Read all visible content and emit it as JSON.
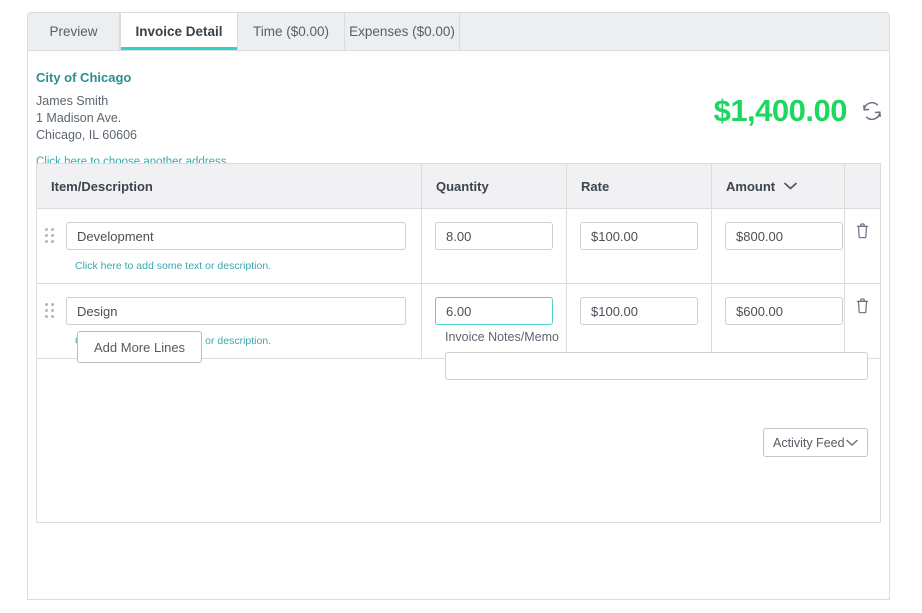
{
  "tabs": [
    {
      "label": "Preview",
      "active": false
    },
    {
      "label": "Invoice Detail",
      "active": true
    },
    {
      "label": "Time ($0.00)",
      "active": false
    },
    {
      "label": "Expenses ($0.00)",
      "active": false
    }
  ],
  "address": {
    "company": "City of Chicago",
    "contact": "James Smith",
    "street": "1 Madison Ave.",
    "city_state_zip": "Chicago, IL 60606",
    "change_link": "Click here to choose another address."
  },
  "total": {
    "amount": "$1,400.00",
    "refresh_icon": "refresh-icon",
    "color": "#1ed760"
  },
  "table": {
    "headers": {
      "description": "Item/Description",
      "quantity": "Quantity",
      "rate": "Rate",
      "amount": "Amount",
      "amount_sort_icon": "chevron-down-icon",
      "delete": ""
    },
    "rows": [
      {
        "drag_handle_icon": "drag-handle-icon",
        "description": "Development",
        "description_placeholder": "",
        "sub_link": "Click here to add some text or description.",
        "quantity": "8.00",
        "rate": "$100.00",
        "amount": "$800.00",
        "delete_icon": "trash-icon",
        "focused_field": ""
      },
      {
        "drag_handle_icon": "drag-handle-icon",
        "description": "Design",
        "description_placeholder": "",
        "sub_link": "Click here to add some text or description.",
        "quantity": "6.00",
        "rate": "$100.00",
        "amount": "$600.00",
        "delete_icon": "trash-icon",
        "focused_field": "quantity"
      }
    ]
  },
  "footer": {
    "add_lines_label": "Add More Lines",
    "notes_label": "Invoice Notes/Memo",
    "notes_value": "",
    "notes_placeholder": "",
    "activity_feed_label": "Activity Feed",
    "activity_feed_icon": "chevron-down-icon"
  },
  "theme": {
    "accent_teal": "#2fd2c5",
    "link_teal": "#3aa8ae",
    "total_green": "#1ed760",
    "border_gray": "#dcdcdc",
    "header_bg": "#f1f1f4",
    "tabstrip_bg": "#eceef0"
  }
}
